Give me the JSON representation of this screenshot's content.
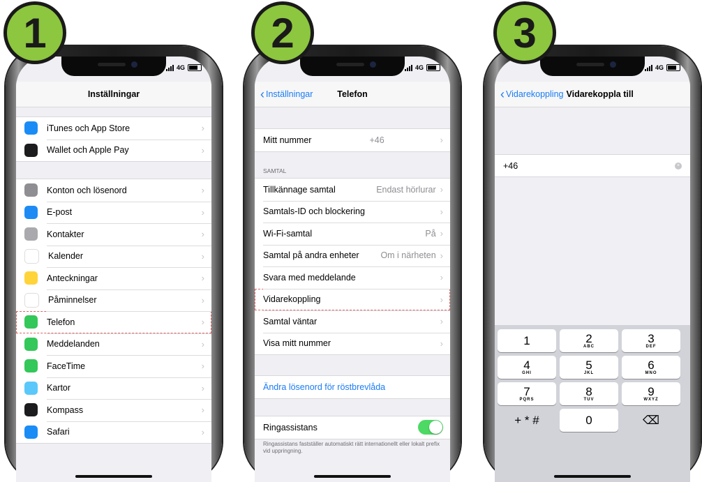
{
  "badges": [
    "1",
    "2",
    "3"
  ],
  "status": {
    "network": "4G"
  },
  "phone1": {
    "title": "Inställningar",
    "group1": [
      {
        "label": "iTunes och App Store",
        "icon": "app-store-icon",
        "color": "#1a8cf5"
      },
      {
        "label": "Wallet och Apple Pay",
        "icon": "wallet-icon",
        "color": "#1c1c1e"
      }
    ],
    "group2": [
      {
        "label": "Konton och lösenord",
        "icon": "key-icon",
        "color": "#8e8e93"
      },
      {
        "label": "E-post",
        "icon": "mail-icon",
        "color": "#1e8bf5"
      },
      {
        "label": "Kontakter",
        "icon": "contacts-icon",
        "color": "#a9a9ae"
      },
      {
        "label": "Kalender",
        "icon": "calendar-icon",
        "color": "#ffffff"
      },
      {
        "label": "Anteckningar",
        "icon": "notes-icon",
        "color": "#ffd43b"
      },
      {
        "label": "Påminnelser",
        "icon": "reminders-icon",
        "color": "#ffffff"
      },
      {
        "label": "Telefon",
        "icon": "phone-icon",
        "color": "#34c759"
      },
      {
        "label": "Meddelanden",
        "icon": "messages-icon",
        "color": "#34c759"
      },
      {
        "label": "FaceTime",
        "icon": "facetime-icon",
        "color": "#34c759"
      },
      {
        "label": "Kartor",
        "icon": "maps-icon",
        "color": "#5ac8fa"
      },
      {
        "label": "Kompass",
        "icon": "compass-icon",
        "color": "#1c1c1e"
      },
      {
        "label": "Safari",
        "icon": "safari-icon",
        "color": "#1a8cf5"
      }
    ]
  },
  "phone2": {
    "back": "Inställningar",
    "title": "Telefon",
    "my_number": {
      "label": "Mitt nummer",
      "value": "+46"
    },
    "section": "SAMTAL",
    "calls": [
      {
        "label": "Tillkännage samtal",
        "value": "Endast hörlurar"
      },
      {
        "label": "Samtals-ID och blockering",
        "value": ""
      },
      {
        "label": "Wi-Fi-samtal",
        "value": "På"
      },
      {
        "label": "Samtal på andra enheter",
        "value": "Om i närheten"
      },
      {
        "label": "Svara med meddelande",
        "value": ""
      },
      {
        "label": "Vidarekoppling",
        "value": ""
      },
      {
        "label": "Samtal väntar",
        "value": ""
      },
      {
        "label": "Visa mitt nummer",
        "value": ""
      }
    ],
    "voicemail_link": "Ändra lösenord för röstbrevlåda",
    "ring_assist": {
      "label": "Ringassistans",
      "on": true
    },
    "ring_assist_note": "Ringassistans fastställer automatiskt rätt internationellt eller lokalt prefix vid uppringning."
  },
  "phone3": {
    "back": "Vidarekoppling",
    "title": "Vidarekoppla till",
    "field_value": "+46",
    "keys": [
      {
        "d": "1",
        "l": ""
      },
      {
        "d": "2",
        "l": "ABC"
      },
      {
        "d": "3",
        "l": "DEF"
      },
      {
        "d": "4",
        "l": "GHI"
      },
      {
        "d": "5",
        "l": "JKL"
      },
      {
        "d": "6",
        "l": "MNO"
      },
      {
        "d": "7",
        "l": "PQRS"
      },
      {
        "d": "8",
        "l": "TUV"
      },
      {
        "d": "9",
        "l": "WXYZ"
      },
      {
        "d": "+ * #",
        "l": ""
      },
      {
        "d": "0",
        "l": ""
      },
      {
        "d": "⌫",
        "l": ""
      }
    ]
  }
}
